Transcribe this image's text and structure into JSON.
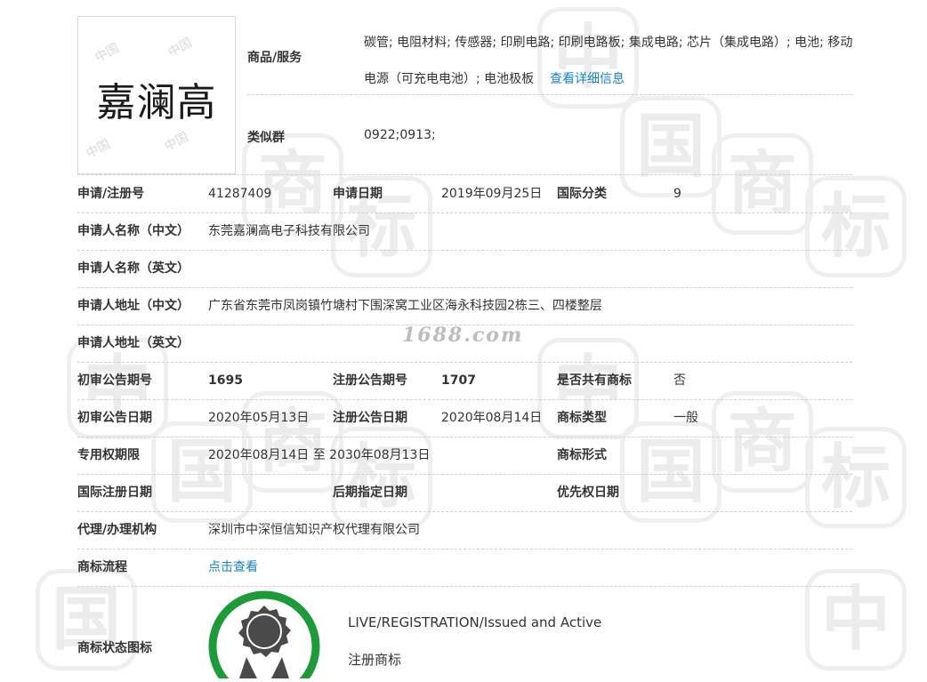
{
  "logo": {
    "text": "嘉澜高",
    "watermark": "中国"
  },
  "watermark": {
    "chars": [
      "中",
      "国",
      "商",
      "标"
    ],
    "site": "1688.com"
  },
  "goods": {
    "label": "商品/服务",
    "value": "碳管; 电阻材料; 传感器; 印刷电路; 印刷电路板; 集成电路; 芯片（集成电路）; 电池; 移动电源（可充电电池）; 电池极板",
    "link": "查看详细信息"
  },
  "similar_group": {
    "label": "类似群",
    "value": "0922;0913;"
  },
  "rows": {
    "reg_no_label": "申请/注册号",
    "reg_no": "41287409",
    "apply_date_label": "申请日期",
    "apply_date": "2019年09月25日",
    "intl_class_label": "国际分类",
    "intl_class": "9",
    "applicant_cn_label": "申请人名称（中文）",
    "applicant_cn": "东莞嘉澜高电子科技有限公司",
    "applicant_en_label": "申请人名称（英文）",
    "address_cn_label": "申请人地址（中文）",
    "address_cn": "广东省东莞市凤岗镇竹塘村下围深窝工业区海永科技园2栋三、四楼整层",
    "address_en_label": "申请人地址（英文）",
    "prelim_no_label": "初审公告期号",
    "prelim_no": "1695",
    "reg_pub_no_label": "注册公告期号",
    "reg_pub_no": "1707",
    "shared_label": "是否共有商标",
    "shared": "否",
    "prelim_date_label": "初审公告日期",
    "prelim_date": "2020年05月13日",
    "reg_pub_date_label": "注册公告日期",
    "reg_pub_date": "2020年08月14日",
    "tm_type_label": "商标类型",
    "tm_type": "一般",
    "term_label": "专用权期限",
    "term": "2020年08月14日 至 2030年08月13日",
    "tm_form_label": "商标形式",
    "intl_reg_date_label": "国际注册日期",
    "later_date_label": "后期指定日期",
    "priority_date_label": "优先权日期",
    "agent_label": "代理/办理机构",
    "agent": "深圳市中深恒信知识产权代理有限公司",
    "flow_label": "商标流程",
    "flow_link": "点击查看"
  },
  "status": {
    "label": "商标状态图标",
    "text_en": "LIVE/REGISTRATION/Issued and Active",
    "text_cn": "注册商标",
    "ring_color": "#1f9a3a",
    "medal_color": "#4a4a4a",
    "icon": "registered-medal-icon"
  },
  "colors": {
    "link": "#1a82c4",
    "label": "#333333",
    "divider": "#cfcfcf"
  }
}
